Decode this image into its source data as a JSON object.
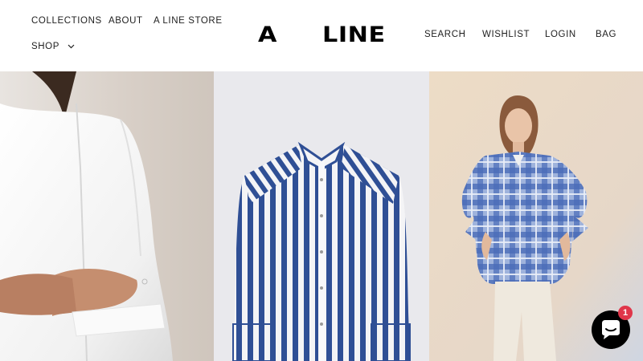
{
  "header": {
    "nav_left": {
      "collections": "COLLECTIONS",
      "about": "ABOUT",
      "store": "A LINE STORE",
      "shop": "SHOP"
    },
    "logo_left": "A",
    "logo_right": "LINE",
    "nav_right": {
      "search": "SEARCH",
      "wishlist": "WISHLIST",
      "login": "LOGIN",
      "bag": "BAG"
    }
  },
  "hero_panels": [
    {
      "name": "white-shirt-closeup",
      "background": "#d9d2cb"
    },
    {
      "name": "blue-striped-shirt",
      "background": "#e8e8ec"
    },
    {
      "name": "plaid-shirt-model",
      "background": "#e6d8c6"
    }
  ],
  "chat": {
    "badge_count": "1",
    "button_color": "#000000",
    "badge_color": "#e0364a"
  }
}
